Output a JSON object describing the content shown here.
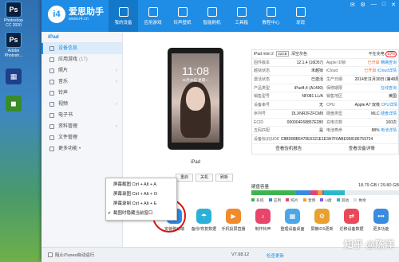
{
  "desktop": {
    "icons": [
      {
        "label": "Photoshop CC 2020",
        "glyph": "Ps",
        "color": "#0b1e3c"
      },
      {
        "label": "Adobe Photosh...",
        "glyph": "Ps",
        "color": "#0b1e3c"
      },
      {
        "label": "",
        "glyph": "▦",
        "color": "#1e3f8a"
      },
      {
        "label": "",
        "glyph": "◼",
        "color": "#3a8b2a"
      }
    ]
  },
  "app": {
    "logo_name": "爱思助手",
    "logo_url": "www.i4.cn",
    "nav": [
      "我的设备",
      "应用游戏",
      "铃声壁纸",
      "智能刷机",
      "工具箱",
      "教程中心",
      "发现"
    ],
    "window_controls": [
      "✉",
      "⚙",
      "—",
      "□",
      "✕"
    ]
  },
  "sidebar": {
    "device": "iPad",
    "items": [
      {
        "label": "设备信息",
        "count": ""
      },
      {
        "label": "应用游戏",
        "count": "(17)"
      },
      {
        "label": "照片",
        "count": ""
      },
      {
        "label": "音乐",
        "count": ""
      },
      {
        "label": "铃声",
        "count": ""
      },
      {
        "label": "视频",
        "count": ""
      },
      {
        "label": "电子书",
        "count": ""
      },
      {
        "label": "资料管理",
        "count": ""
      },
      {
        "label": "文件管理",
        "count": ""
      },
      {
        "label": "更多功能",
        "count": ""
      }
    ]
  },
  "context_menu": [
    "屏幕截图 Ctrl + Alt + A",
    "屏幕录图 Ctrl + Alt + O",
    "屏幕录制 Ctrl + Alt + E",
    "截图时隐藏当前窗口"
  ],
  "device": {
    "clock": "11:08",
    "date": "11月30日 星期一",
    "name": "iPad",
    "buttons": [
      "重启",
      "关机",
      "刷新"
    ]
  },
  "info": {
    "model": "iPad mini 2",
    "capacity": "32GB",
    "color": "深空灰色",
    "charging": "不在充电",
    "battery": "10%",
    "rows": [
      {
        "k1": "固件版本",
        "v1": "12.1.4 (16D57)",
        "k2": "Apple ID锁",
        "v2": "已开启",
        "v2b": "精确查询"
      },
      {
        "k1": "越狱状态",
        "v1": "未越狱",
        "k2": "iCloud",
        "v2": "已开启",
        "v2b": "iCloud详情"
      },
      {
        "k1": "激活状态",
        "v1": "已激活",
        "k2": "生产日期",
        "v2": "2014年11月30日",
        "v2b": "(第48周)"
      },
      {
        "k1": "产品类型",
        "v1": "iPad4,4 (A1490)",
        "k2": "保修期限",
        "v2": "",
        "v2b": "在线查询"
      },
      {
        "k1": "销售型号",
        "v1": "NF081 LL/A",
        "k2": "销售地区",
        "v2": "美国",
        "v2b": ""
      },
      {
        "k1": "设备串号",
        "v1": "无",
        "k2": "CPU",
        "v2": "Apple A7 双核",
        "v2b": "CPU详情"
      },
      {
        "k1": "序列号",
        "v1": "DLXNR2FZFCM8",
        "k2": "硬盘类型",
        "v2": "MLC",
        "v2b": "硬盘详情"
      },
      {
        "k1": "ECID",
        "v1": "000004F68857E280",
        "k2": "充电次数",
        "v2": "160次",
        "v2b": ""
      },
      {
        "k1": "五码匹配",
        "v1": "是",
        "k2": "电池寿命",
        "v2": "88%",
        "v2b": "电池详情"
      },
      {
        "k1": "设备标识(UDID)",
        "v1": "C8BD88B5470E6321E1E3A7F0ABE958186759724",
        "k2": "",
        "v2": "",
        "v2b": ""
      }
    ],
    "report_buttons": [
      "查看验机报告",
      "查看设备详情"
    ]
  },
  "disk": {
    "label": "硬盘容量",
    "value": "18.79 GB / 29.80 GB",
    "legend": [
      {
        "name": "系统",
        "color": "#3fb34f"
      },
      {
        "name": "应用",
        "color": "#3a8be0"
      },
      {
        "name": "照片",
        "color": "#e0457a"
      },
      {
        "name": "音频",
        "color": "#f0a030"
      },
      {
        "name": "U盘",
        "color": "#8a5ad8"
      },
      {
        "name": "其他",
        "color": "#2bb8c8"
      },
      {
        "name": "剩余",
        "color": "#d8dde2"
      }
    ],
    "segments": [
      0.3,
      0.1,
      0.05,
      0.03,
      0.01,
      0.14
    ]
  },
  "tools": [
    {
      "label": "安装移动端",
      "color": "#2a8be6",
      "glyph": "i4"
    },
    {
      "label": "备份/恢复数据",
      "color": "#2bb0d8",
      "glyph": "☂"
    },
    {
      "label": "手机投屏直播",
      "color": "#f08a2a",
      "glyph": "▶"
    },
    {
      "label": "制作铃声",
      "color": "#e8456a",
      "glyph": "♪"
    },
    {
      "label": "整理设备桌面",
      "color": "#4aa8e8",
      "glyph": "▦"
    },
    {
      "label": "屏蔽iOS更新",
      "color": "#e8a030",
      "glyph": "⚙"
    },
    {
      "label": "迁移设备数据",
      "color": "#e84a5a",
      "glyph": "⇄"
    },
    {
      "label": "更多功能",
      "color": "#3a8be0",
      "glyph": "•••"
    }
  ],
  "status": {
    "itunes": "阻止iTunes自动运行",
    "version": "V7.98.12",
    "update": "检查更新"
  },
  "watermark": "知乎 @陈洋"
}
